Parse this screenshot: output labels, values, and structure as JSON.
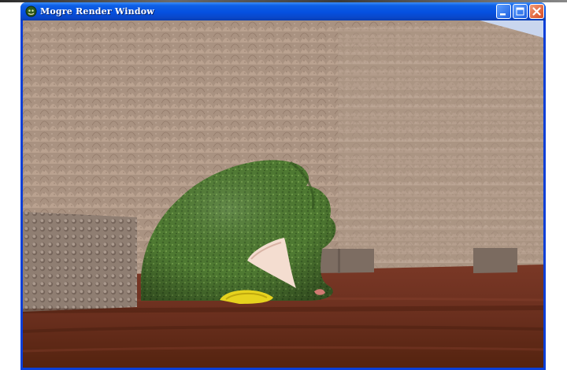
{
  "window": {
    "title": "Mogre Render Window",
    "frame_color": "#0a3fd8",
    "title_text_color": "#ffffff"
  },
  "titlebar": {
    "app_icon": "ogre-head-icon",
    "buttons": [
      "minimize-icon",
      "maximize-icon",
      "close-icon"
    ]
  },
  "viewport": {
    "scene": "3D ogre head model in a courtyard with textured walls",
    "colors": {
      "wall": "#b39a88",
      "floor": "#6a2f1e",
      "ogre_skin": "#4f7a32",
      "tusk": "#f4ddd0",
      "ring": "#e6d21e",
      "sky": "#c9d6ee",
      "cube": "#9f8b7d"
    }
  }
}
